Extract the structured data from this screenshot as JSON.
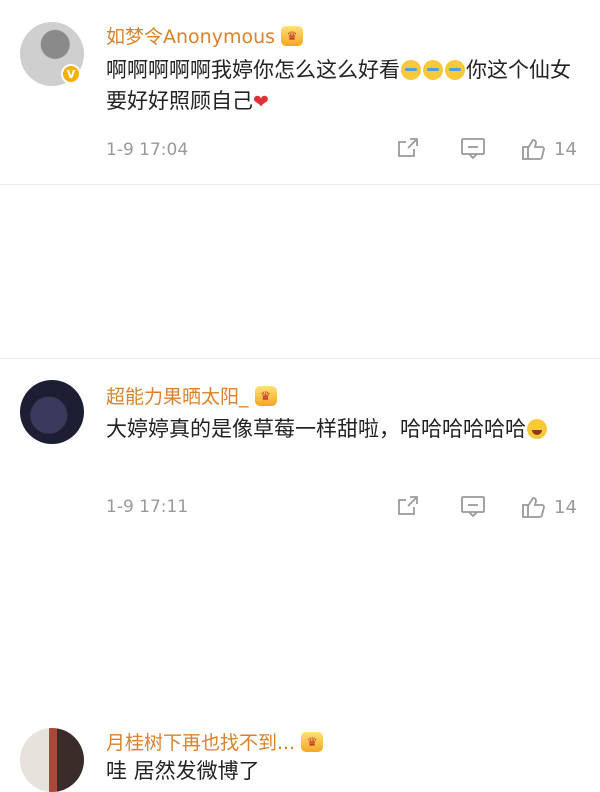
{
  "comments": [
    {
      "username": "如梦令Anonymous",
      "text_parts": [
        "啊啊啊啊啊我婷你怎么这么好看",
        "你这个仙女要好好照顾自己"
      ],
      "time": "1-9 17:04",
      "likes": "14",
      "verified_badge": "V"
    },
    {
      "username": "超能力果晒太阳_",
      "text_parts": [
        "大婷婷真的是像草莓一样甜啦，哈哈哈哈哈哈"
      ],
      "time": "1-9 17:11",
      "likes": "14"
    },
    {
      "username": "月桂树下再也找不到...",
      "text_parts": [
        "哇 居然发微博了"
      ]
    }
  ],
  "icons": {
    "crown": "crown-icon",
    "share": "share-icon",
    "reply": "comment-icon",
    "like": "thumbs-up-icon",
    "emoji_cry": "crying-emoji-icon",
    "emoji_laugh": "laughing-emoji-icon",
    "heart": "heart-icon"
  },
  "colors": {
    "username": "#d9822b",
    "meta_gray": "#999999",
    "heart": "#e0303a"
  }
}
